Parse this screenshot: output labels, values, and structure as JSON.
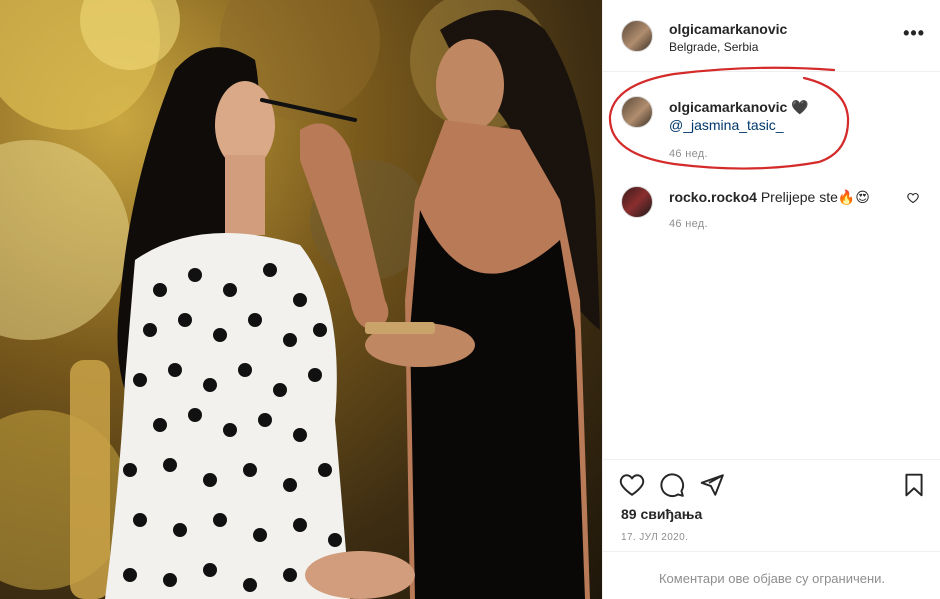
{
  "post": {
    "username": "olgicamarkanovic",
    "location": "Belgrade, Serbia",
    "more_icon": "more-options-icon",
    "caption": {
      "username": "olgicamarkanovic",
      "emoji": "🖤",
      "mention": "@_jasmina_tasic_",
      "time": "46 нед."
    },
    "comments": [
      {
        "username": "rocko.rocko4",
        "text": "Prelijepe ste🔥😍",
        "time": "46 нед."
      }
    ],
    "actions": {
      "like_icon": "heart-icon",
      "comment_icon": "comment-icon",
      "share_icon": "share-icon",
      "save_icon": "bookmark-icon"
    },
    "likes": "89 свиђања",
    "date": "17. ЈУЛ 2020.",
    "comments_disabled": "Коментари ове објаве су ограничени."
  },
  "colors": {
    "annotation_circle": "#d42a2a",
    "mention": "#00376b",
    "muted": "#8e8e8e"
  }
}
